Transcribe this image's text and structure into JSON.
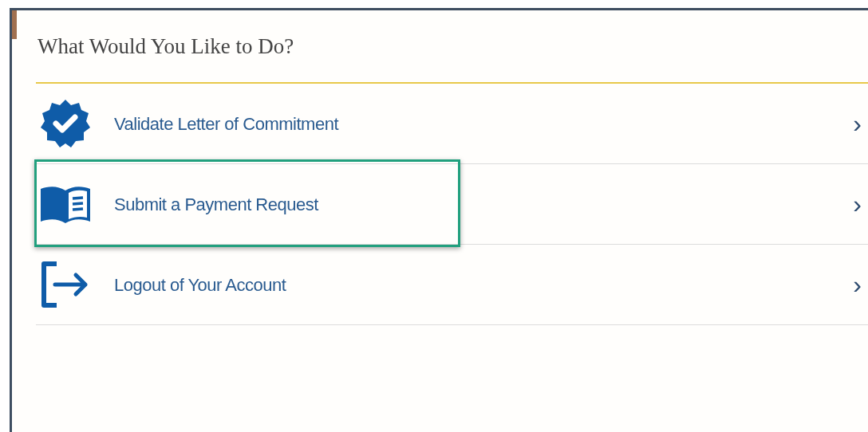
{
  "panel": {
    "title": "What Would You Like to Do?"
  },
  "items": [
    {
      "kind": "verified",
      "label": "Validate Letter of Commitment",
      "chevron": "›",
      "highlighted": false
    },
    {
      "kind": "book",
      "label": "Submit a Payment Request",
      "chevron": "›",
      "highlighted": true
    },
    {
      "kind": "logout",
      "label": "Logout of Your Account",
      "chevron": "›",
      "highlighted": false
    }
  ]
}
